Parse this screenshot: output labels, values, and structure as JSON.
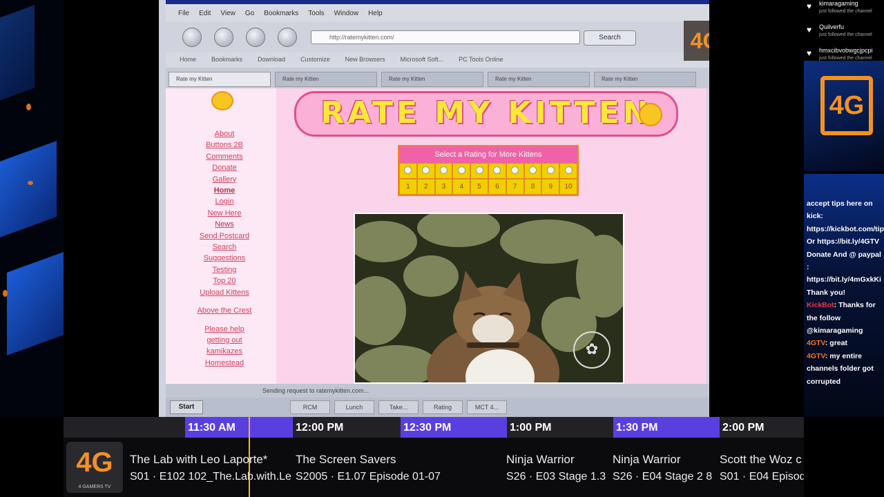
{
  "browser": {
    "menu": [
      "File",
      "Edit",
      "View",
      "Go",
      "Bookmarks",
      "Tools",
      "Window",
      "Help"
    ],
    "url": "http://ratemykitten.com/",
    "search_label": "Search",
    "links": [
      "Home",
      "Bookmarks",
      "Download",
      "Customize",
      "New Browsers",
      "Microsoft Soft...",
      "PC Tools Online"
    ],
    "tabs": [
      "Rate my Kitten",
      "Rate my Kitten",
      "Rate my Kitten",
      "Rate my Kitten",
      "Rate my Kitten"
    ],
    "status": "Sending request to ratemykitten.com...",
    "taskbar": {
      "start": "Start",
      "items": [
        "RCM",
        "Lunch",
        "Take...",
        "Rating",
        "MCT 4..."
      ]
    }
  },
  "site": {
    "banner": "RATE MY KITTEN",
    "rating_header": "Select a Rating for More Kittens",
    "rating_numbers": [
      "1",
      "2",
      "3",
      "4",
      "5",
      "6",
      "7",
      "8",
      "9",
      "10"
    ],
    "side_links": [
      "About",
      "Buttons 2B",
      "Comments",
      "Donate",
      "Gallery",
      "Home",
      "Login",
      "New Here",
      "News",
      "Send Postcard",
      "Search",
      "Suggestions",
      "Testing",
      "Top 20",
      "Upload Kittens",
      "Above the Crest",
      "Please help",
      "getting out",
      "kamikazes",
      "Homestead"
    ]
  },
  "overlay_logo": "4G",
  "chat": {
    "follows": [
      {
        "name": "kimaragaming",
        "sub": "just followed the channel"
      },
      {
        "name": "Quilverfu",
        "sub": "just followed the channel"
      },
      {
        "name": "hmxcibvobwgcjpcpi",
        "sub": "just followed the channel"
      }
    ],
    "logo": "4G",
    "intro": "accept tips here on kick: https://kickbot.com/tips/4GTV Or https://bit.ly/4GTV Donate And @ paypal : https://bit.ly/4mGxkKi Thank you!",
    "messages": [
      {
        "user": "KickBot",
        "text": "Thanks for the follow @kimaragaming"
      },
      {
        "user": "4GTV",
        "text": "great"
      },
      {
        "user": "4GTV",
        "text": "my entire channels folder got corrupted"
      }
    ]
  },
  "guide": {
    "times": [
      "11:30 AM",
      "12:00 PM",
      "12:30 PM",
      "1:00 PM",
      "1:30 PM",
      "2:00 PM"
    ],
    "channel": {
      "logo": "4G",
      "sub": "4 GAMERS TV"
    },
    "programs": [
      {
        "title": "The Lab with Leo Laporte*",
        "ep": "S01 · E102 102_The.Lab.with.Le"
      },
      {
        "title": "The Screen Savers",
        "ep": "S2005 · E1.07 Episode 01-07"
      },
      {
        "title": "Ninja Warrior",
        "ep": "S26 · E03 Stage 1.3"
      },
      {
        "title": "Ninja Warrior",
        "ep": "S26 · E04 Stage 2 8"
      },
      {
        "title": "Scott the Woz c",
        "ep": "S01 · E04 Episod"
      }
    ]
  },
  "colors": {
    "accent": "#5a3fe0",
    "brand": "#f3921f",
    "page_pink": "#fbd3ea",
    "now_line": "#f7b81f"
  }
}
